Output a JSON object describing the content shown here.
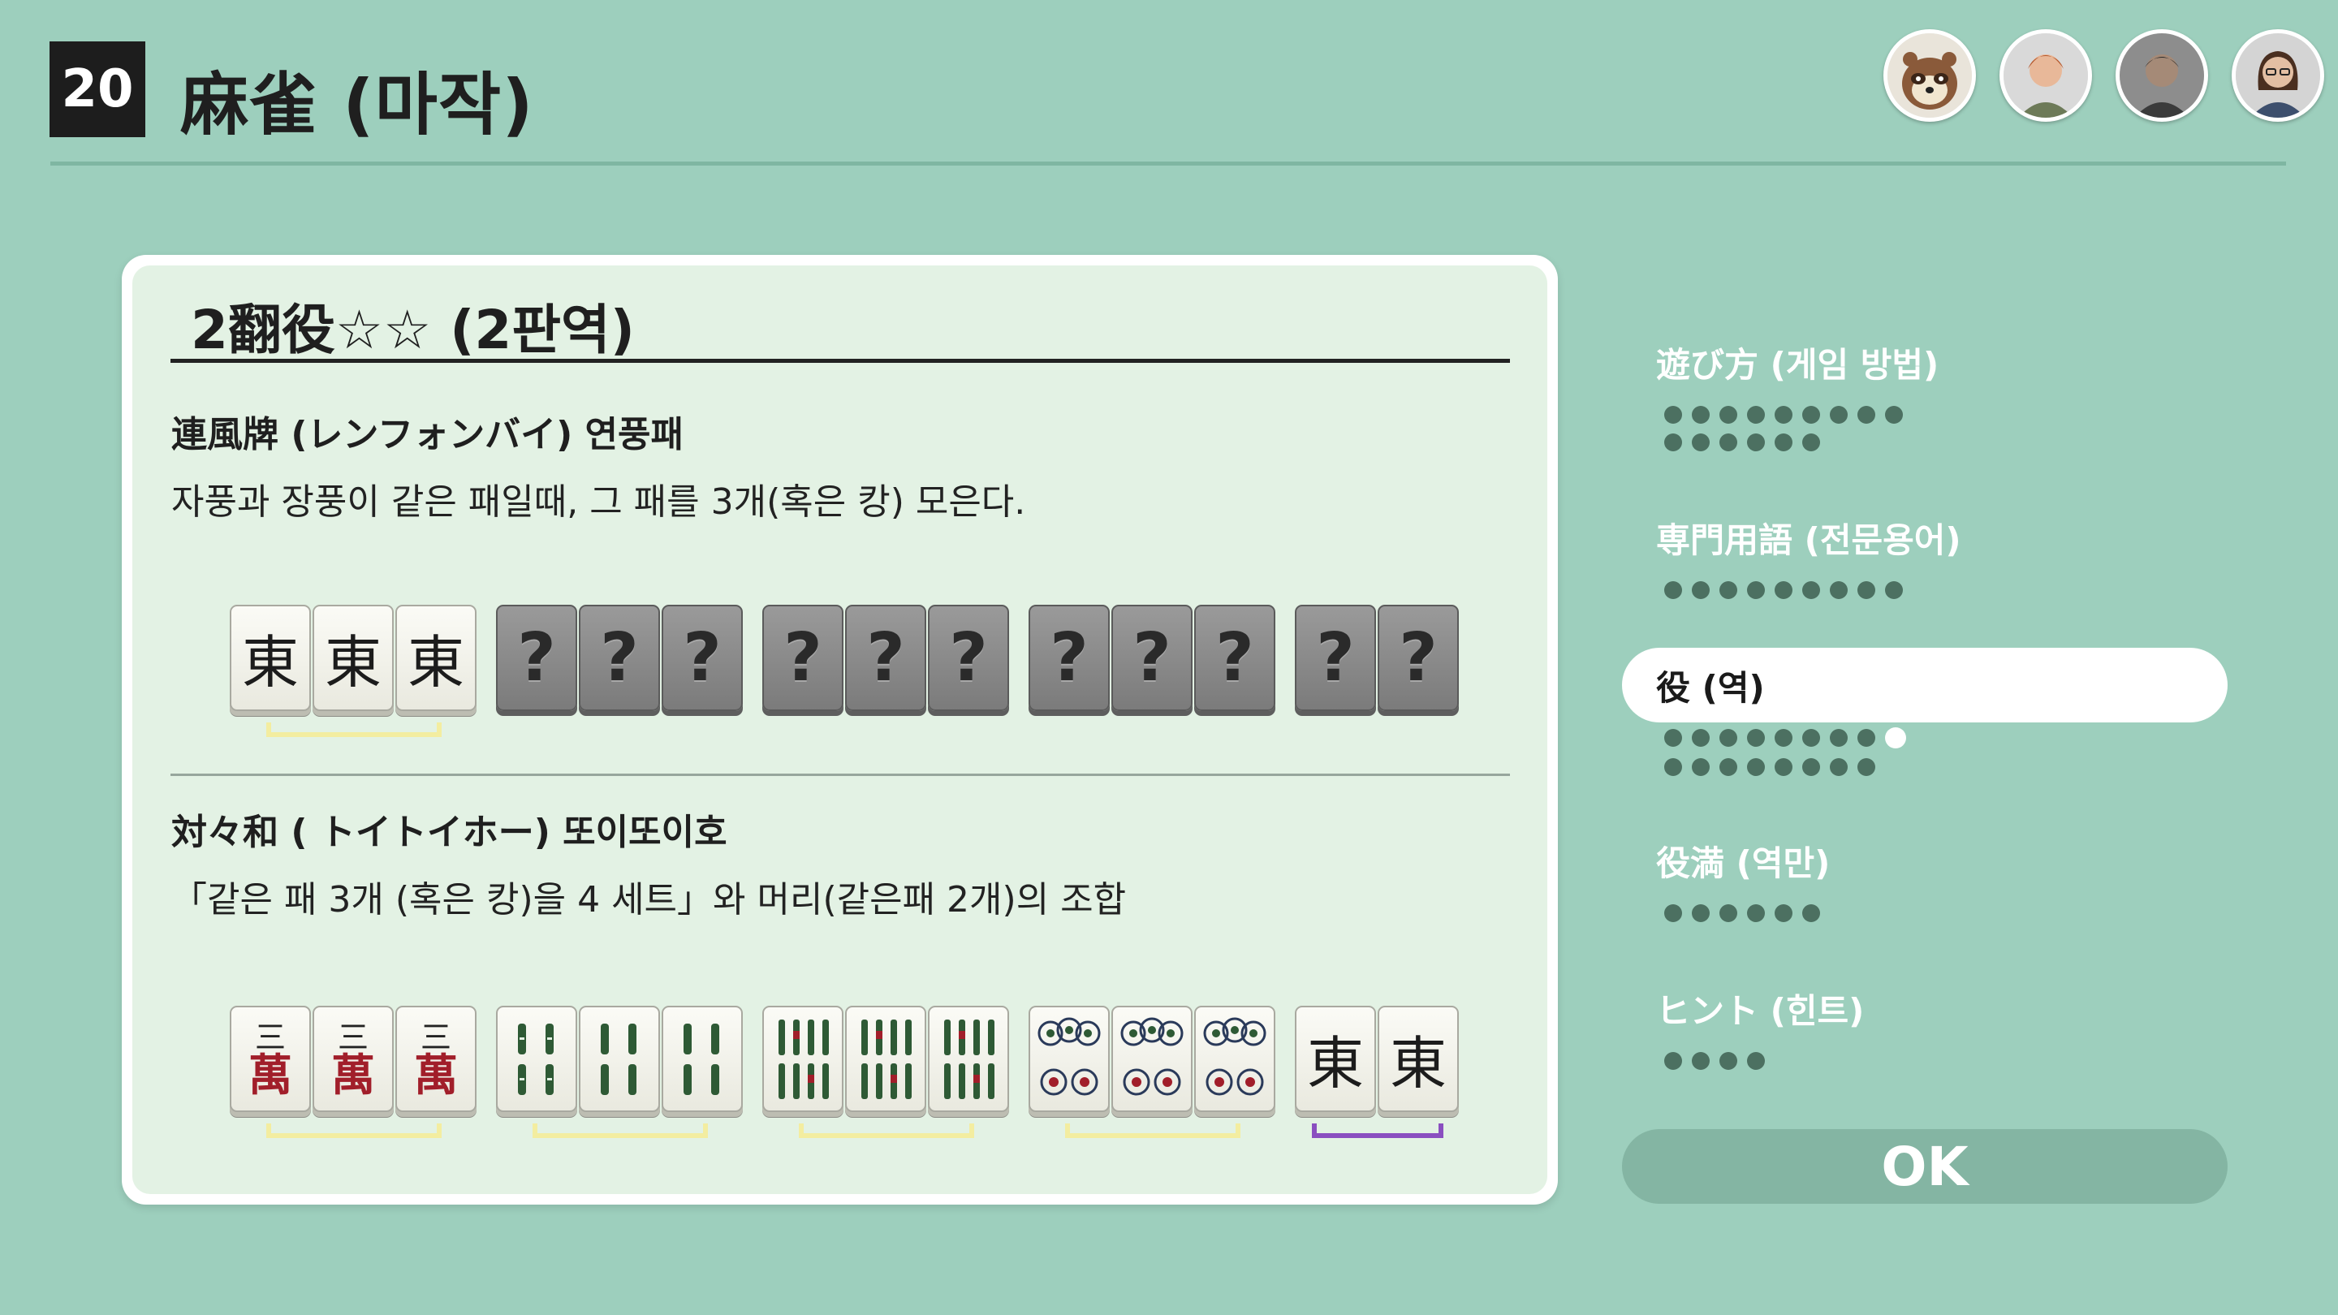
{
  "header": {
    "number": "20",
    "title": "麻雀 (마작)"
  },
  "players": [
    {
      "name": "avatar-tanuki"
    },
    {
      "name": "avatar-player-1"
    },
    {
      "name": "avatar-player-2"
    },
    {
      "name": "avatar-player-3"
    }
  ],
  "card": {
    "title": "2翻役☆☆ (2판역)",
    "section1": {
      "heading": "連風牌 (レンフォンバイ) 연풍패",
      "description": "자풍과 장풍이 같은 패일때, 그 패를 3개(혹은 캉) 모은다.",
      "tiles": {
        "east": "東",
        "unknown": "?"
      }
    },
    "section2": {
      "heading": "対々和 ( トイトイホー) 또이또이호",
      "description": "「같은 패 3개 (혹은 캉)을 4 세트」와 머리(같은패 2개)의 조합",
      "tiles": {
        "three": "三",
        "wan": "萬",
        "east": "東"
      }
    }
  },
  "menu": {
    "items": [
      {
        "label": "遊び方 (게임 방법)",
        "pages": 15,
        "current": 0
      },
      {
        "label": "専門用語 (전문용어)",
        "pages": 9,
        "current": 0
      },
      {
        "label": "役 (역)",
        "pages": 17,
        "current": 8
      },
      {
        "label": "役満 (역만)",
        "pages": 6,
        "current": 0
      },
      {
        "label": "ヒント (힌트)",
        "pages": 4,
        "current": 0
      }
    ],
    "active_index": 2,
    "ok_label": "OK"
  },
  "colors": {
    "background": "#9dcfbd",
    "set_bracket": "#f3eda0",
    "pair_bracket": "#8a4fc0",
    "wan_red": "#a11e2a"
  }
}
